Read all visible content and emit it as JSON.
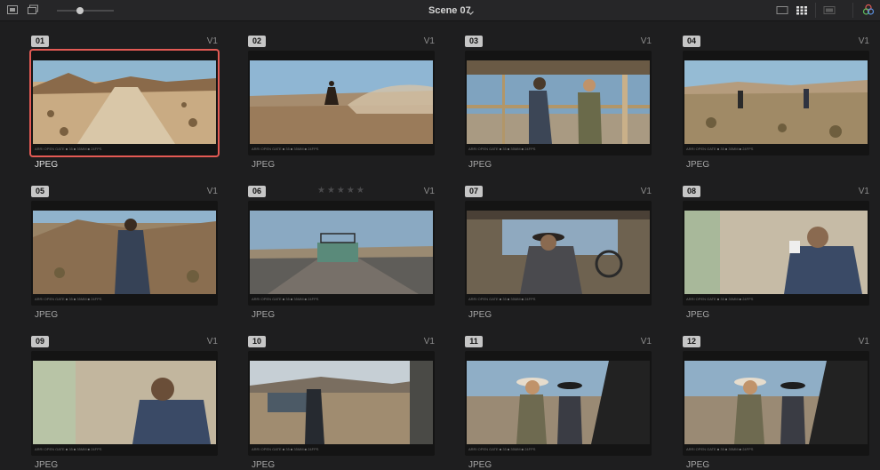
{
  "toolbar": {
    "scene_title": "Scene 07",
    "icons": [
      "frame-icon",
      "clip-stack-icon",
      "list-view-icon",
      "grid-view-icon",
      "panel-icon",
      "color-wheel-icon"
    ],
    "thumbnail_size_level": 0.4
  },
  "clips": [
    {
      "number": "01",
      "track": "V1",
      "format": "JPEG",
      "selected": true,
      "meta": "ARRI OPEN GATE ■ 35 ■ 35MM ■ 24FPS"
    },
    {
      "number": "02",
      "track": "V1",
      "format": "JPEG",
      "selected": false,
      "meta": "ARRI OPEN GATE ■ 35 ■ 35MM ■ 24FPS"
    },
    {
      "number": "03",
      "track": "V1",
      "format": "JPEG",
      "selected": false,
      "meta": "ARRI OPEN GATE ■ 35 ■ 35MM ■ 24FPS"
    },
    {
      "number": "04",
      "track": "V1",
      "format": "JPEG",
      "selected": false,
      "meta": "ARRI OPEN GATE ■ 35 ■ 35MM ■ 24FPS"
    },
    {
      "number": "05",
      "track": "V1",
      "format": "JPEG",
      "selected": false,
      "meta": "ARRI OPEN GATE ■ 35 ■ 35MM ■ 24FPS"
    },
    {
      "number": "06",
      "track": "V1",
      "format": "JPEG",
      "selected": false,
      "rating": 0,
      "meta": "ARRI OPEN GATE ■ 35 ■ 35MM ■ 24FPS"
    },
    {
      "number": "07",
      "track": "V1",
      "format": "JPEG",
      "selected": false,
      "meta": "ARRI OPEN GATE ■ 35 ■ 35MM ■ 24FPS"
    },
    {
      "number": "08",
      "track": "V1",
      "format": "JPEG",
      "selected": false,
      "meta": "ARRI OPEN GATE ■ 35 ■ 35MM ■ 24FPS"
    },
    {
      "number": "09",
      "track": "V1",
      "format": "JPEG",
      "selected": false,
      "meta": "ARRI OPEN GATE ■ 35 ■ 35MM ■ 24FPS"
    },
    {
      "number": "10",
      "track": "V1",
      "format": "JPEG",
      "selected": false,
      "meta": "ARRI OPEN GATE ■ 35 ■ 35MM ■ 24FPS"
    },
    {
      "number": "11",
      "track": "V1",
      "format": "JPEG",
      "selected": false,
      "meta": "ARRI OPEN GATE ■ 35 ■ 35MM ■ 24FPS"
    },
    {
      "number": "12",
      "track": "V1",
      "format": "JPEG",
      "selected": false,
      "meta": "ARRI OPEN GATE ■ 35 ■ 35MM ■ 24FPS"
    }
  ],
  "colors": {
    "selection": "#e35a54",
    "background": "#1e1e1f"
  }
}
